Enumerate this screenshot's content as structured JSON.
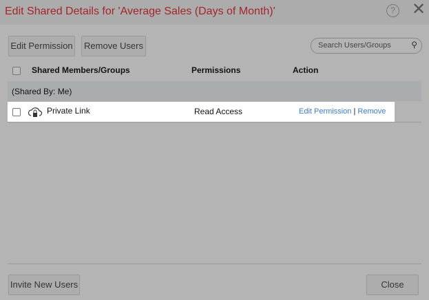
{
  "dialog": {
    "title": "Edit Shared Details for 'Average Sales (Days of Month)'",
    "help": "?",
    "close": "✕"
  },
  "toolbar": {
    "edit_permission": "Edit Permission",
    "remove_users": "Remove Users",
    "search_placeholder": "Search Users/Groups"
  },
  "table": {
    "headers": [
      "Shared Members/Groups",
      "Permissions",
      "Action"
    ],
    "group_label": "(Shared By: Me)",
    "rows": [
      {
        "name": "Private Link",
        "permission": "Read Access",
        "action_edit": "Edit Permission",
        "separator": "|",
        "action_remove": "Remove"
      }
    ]
  },
  "footer": {
    "invite": "Invite New Users",
    "close": "Close"
  }
}
